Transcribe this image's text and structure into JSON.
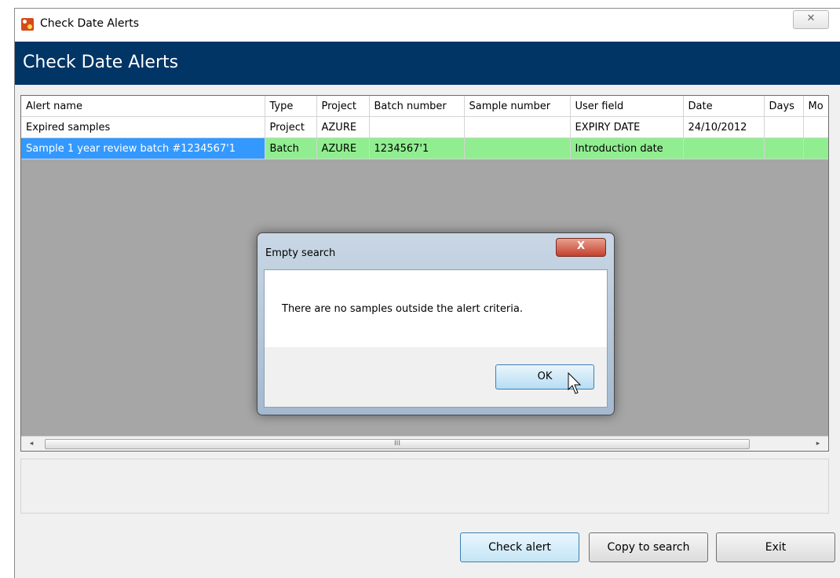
{
  "window": {
    "title": "Check Date Alerts",
    "close_glyph": "✕"
  },
  "banner": {
    "title": "Check Date Alerts",
    "color": "#003566"
  },
  "grid": {
    "columns": [
      "Alert name",
      "Type",
      "Project",
      "Batch number",
      "Sample number",
      "User field",
      "Date",
      "Days",
      "Mo"
    ],
    "rows": [
      [
        "Expired samples",
        "Project",
        "AZURE",
        "",
        "",
        "EXPIRY DATE",
        "24/10/2012",
        "",
        ""
      ],
      [
        "Sample 1 year review batch #1234567'1",
        "Batch",
        "AZURE",
        "1234567'1",
        "",
        "Introduction date",
        "",
        "",
        ""
      ]
    ],
    "selected_row": 1,
    "selected_color": "#3399ff",
    "highlight_color": "#90ee90",
    "scroll_left_glyph": "◂",
    "scroll_right_glyph": "▸",
    "scroll_grip": "III"
  },
  "buttons": {
    "check_alert": "Check alert",
    "copy_to_search": "Copy to search",
    "exit": "Exit"
  },
  "dialog": {
    "title": "Empty search",
    "message": "There are no samples outside the alert criteria.",
    "ok": "OK",
    "close_glyph": "X"
  },
  "icons": {
    "app": "app-icon",
    "cursor": "mouse-pointer-icon"
  }
}
